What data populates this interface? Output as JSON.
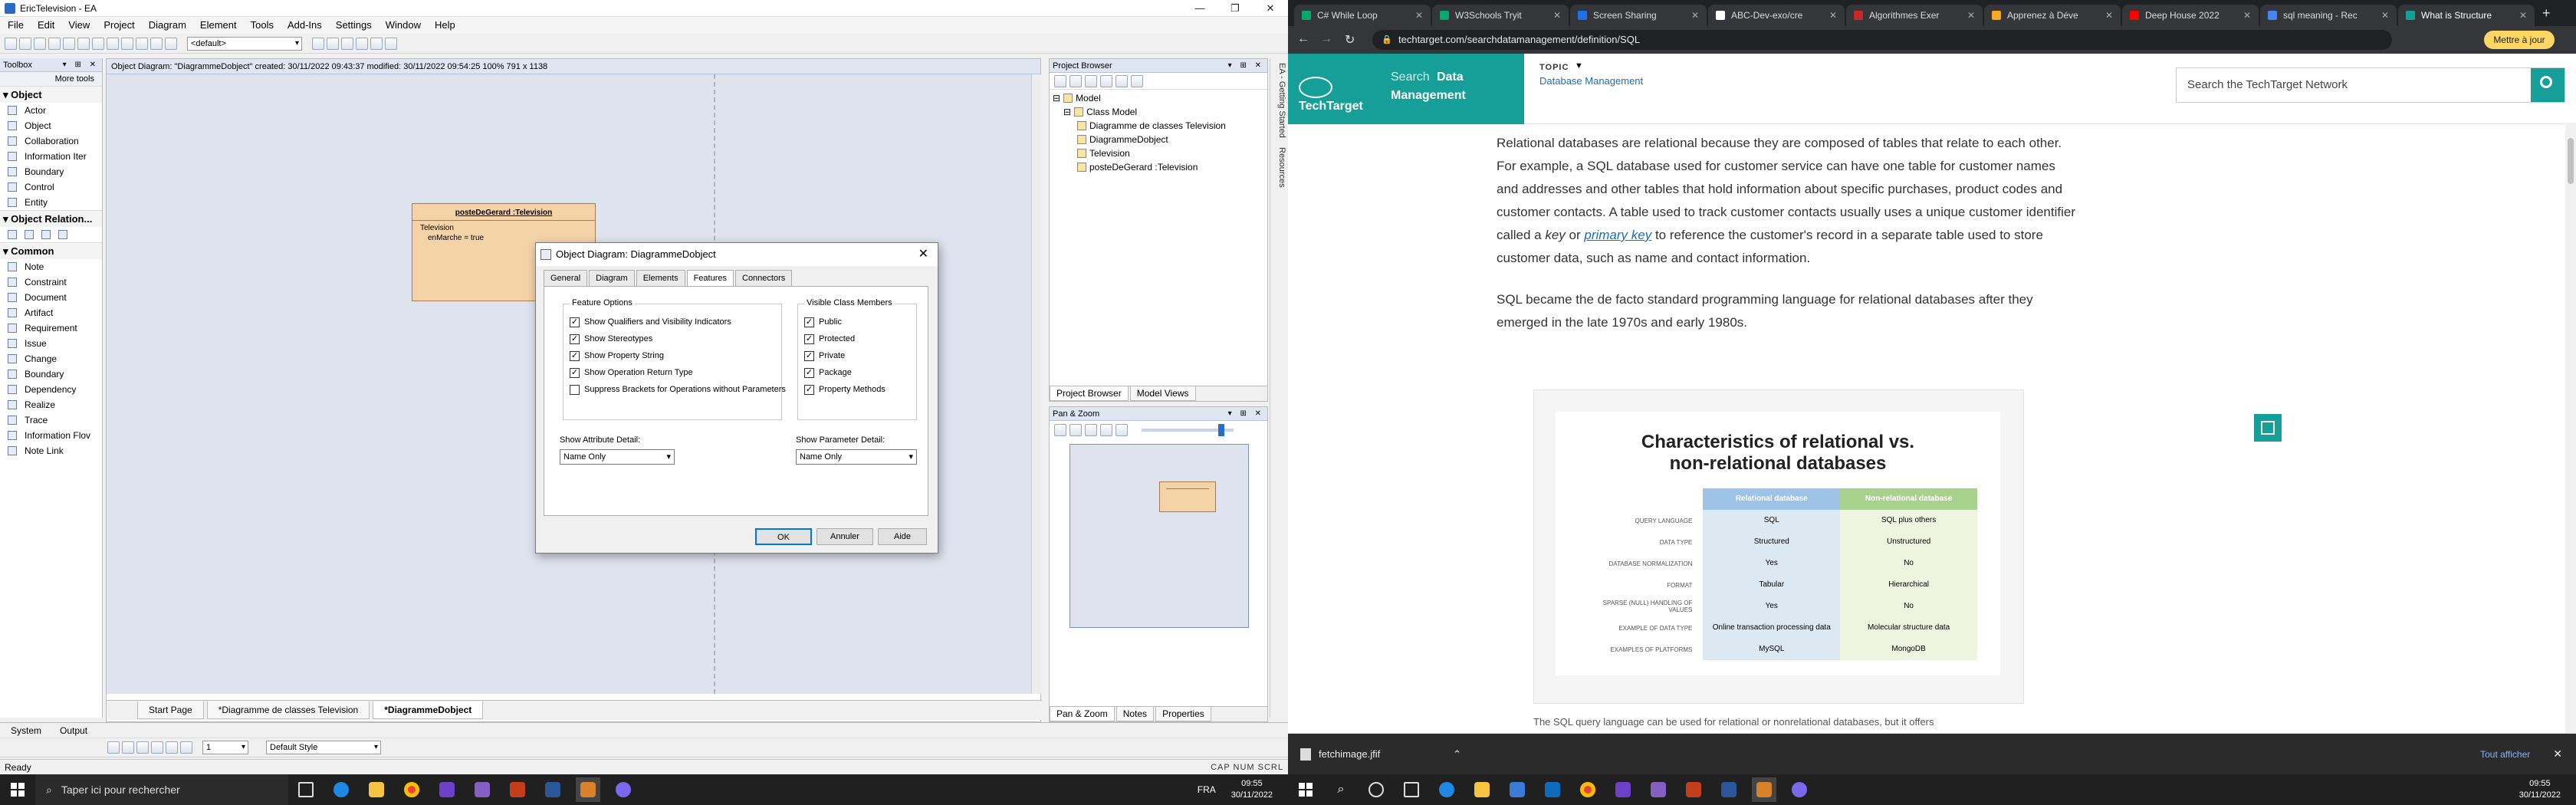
{
  "ea": {
    "title": "EricTelevision - EA",
    "menu": [
      "File",
      "Edit",
      "View",
      "Project",
      "Diagram",
      "Element",
      "Tools",
      "Add-Ins",
      "Settings",
      "Window",
      "Help"
    ],
    "toolbar_select": "<default>",
    "toolbox": {
      "title": "Toolbox",
      "more_tools": "More tools",
      "groups": [
        {
          "name": "Object",
          "items": [
            "Actor",
            "Object",
            "Collaboration",
            "Information Iter",
            "Boundary",
            "Control",
            "Entity"
          ]
        },
        {
          "name": "Object Relation...",
          "items": []
        },
        {
          "name": "Common",
          "items": [
            "Note",
            "Constraint",
            "Document",
            "Artifact",
            "Requirement",
            "Issue",
            "Change",
            "Boundary",
            "Dependency",
            "Realize",
            "Trace",
            "Information Flov",
            "Note Link"
          ]
        }
      ]
    },
    "diagram_header": "Object Diagram: \"DiagrammeDobject\"   created: 30/11/2022 09:43:37  modified: 30/11/2022 09:54:25   100%   791 x 1138",
    "class_box": {
      "name": "posteDeGerard :Television",
      "stereo": "Television",
      "attr": "enMarche = true"
    },
    "doc_tabs": [
      "Start Page",
      "*Diagramme de classes Television",
      "*DiagrammeDobject"
    ],
    "dialog": {
      "title": "Object Diagram: DiagrammeDobject",
      "tabs": [
        "General",
        "Diagram",
        "Elements",
        "Features",
        "Connectors"
      ],
      "feature_group": "Feature Options",
      "feature_options": [
        {
          "label": "Show Qualifiers and Visibility Indicators",
          "checked": true
        },
        {
          "label": "Show Stereotypes",
          "checked": true
        },
        {
          "label": "Show Property String",
          "checked": true
        },
        {
          "label": "Show Operation Return Type",
          "checked": true
        },
        {
          "label": "Suppress Brackets for Operations without Parameters",
          "checked": false
        }
      ],
      "members_group": "Visible Class Members",
      "members": [
        {
          "label": "Public",
          "checked": true
        },
        {
          "label": "Protected",
          "checked": true
        },
        {
          "label": "Private",
          "checked": true
        },
        {
          "label": "Package",
          "checked": true
        },
        {
          "label": "Property Methods",
          "checked": true
        }
      ],
      "attr_detail_label": "Show Attribute Detail:",
      "attr_detail_value": "Name Only",
      "param_detail_label": "Show Parameter Detail:",
      "param_detail_value": "Name Only",
      "ok": "OK",
      "cancel": "Annuler",
      "help": "Aide"
    },
    "project_browser": {
      "title": "Project Browser",
      "tree": [
        {
          "label": "Model",
          "level": 0
        },
        {
          "label": "Class Model",
          "level": 1
        },
        {
          "label": "Diagramme de classes Television",
          "level": 2
        },
        {
          "label": "DiagrammeDobject",
          "level": 2
        },
        {
          "label": "Television",
          "level": 2
        },
        {
          "label": "posteDeGerard :Television",
          "level": 2
        }
      ],
      "tabs": [
        "Project Browser",
        "Model Views"
      ]
    },
    "side_tabs": [
      "EA - Getting Started",
      "Resources"
    ],
    "pan_zoom": {
      "title": "Pan & Zoom",
      "tabs": [
        "Pan & Zoom",
        "Notes",
        "Properties"
      ]
    },
    "bottom_tabs": [
      "System",
      "Output"
    ],
    "style_select": "Default Style",
    "zoom_select": "1",
    "status": "Ready",
    "status_right": "CAP  NUM  SCRL"
  },
  "taskbar_left": {
    "search_placeholder": "Taper ici pour rechercher",
    "lang": "FRA",
    "time": "09:55",
    "date": "30/11/2022"
  },
  "browser": {
    "tabs": [
      {
        "label": "C# While Loop",
        "color": "#04aa6d"
      },
      {
        "label": "W3Schools Tryit",
        "color": "#04aa6d"
      },
      {
        "label": "Screen Sharing",
        "color": "#1a73e8"
      },
      {
        "label": "ABC-Dev-exo/cre",
        "color": "#ffffff"
      },
      {
        "label": "Algorithmes Exer",
        "color": "#c62828"
      },
      {
        "label": "Apprenez à Déve",
        "color": "#f9a825"
      },
      {
        "label": "Deep House 2022",
        "color": "#ff0000"
      },
      {
        "label": "sql meaning - Rec",
        "color": "#4285f4"
      },
      {
        "label": "What is Structure",
        "color": "#169f99"
      }
    ],
    "url": "techtarget.com/searchdatamanagement/definition/SQL",
    "update_button": "Mettre à jour",
    "site": {
      "logo": "TechTarget",
      "search_brand": "Search",
      "search_brand2": "Data",
      "search_brand3": "Management",
      "topic_label": "TOPIC",
      "topic_value": "Database Management",
      "search_placeholder": "Search the TechTarget Network"
    },
    "article": {
      "p1a": "Relational databases are relational because they are composed of tables that relate to each other. For example, a SQL database used for customer service can have one table for customer names and addresses and other tables that hold information about specific purchases, product codes and customer contacts. A table used to track customer contacts usually uses a unique customer identifier called a ",
      "p1_key": "key",
      "p1_or": " or ",
      "p1_link": "primary key",
      "p1b": " to reference the customer's record in a separate table used to store customer data, such as name and contact information.",
      "p2": "SQL became the de facto standard programming language for relational databases after they emerged in the late 1970s and early 1980s.",
      "caption": "The SQL query language can be used for relational or nonrelational databases, but it offers"
    },
    "figure": {
      "title": "Characteristics of relational vs. non-relational databases",
      "col1": "Relational database",
      "col2": "Non-relational database",
      "rows": [
        {
          "k": "QUERY LANGUAGE",
          "a": "SQL",
          "b": "SQL plus others"
        },
        {
          "k": "DATA TYPE",
          "a": "Structured",
          "b": "Unstructured"
        },
        {
          "k": "DATABASE NORMALIZATION",
          "a": "Yes",
          "b": "No"
        },
        {
          "k": "FORMAT",
          "a": "Tabular",
          "b": "Hierarchical"
        },
        {
          "k": "SPARSE (NULL) HANDLING OF VALUES",
          "a": "Yes",
          "b": "No"
        },
        {
          "k": "EXAMPLE OF DATA TYPE",
          "a": "Online transaction processing data",
          "b": "Molecular structure data"
        },
        {
          "k": "EXAMPLES OF PLATFORMS",
          "a": "MySQL",
          "b": "MongoDB"
        }
      ]
    },
    "download": {
      "file": "fetchimage.jfif",
      "show_all": "Tout afficher"
    }
  },
  "taskbar_right": {
    "time": "09:55",
    "date": "30/11/2022"
  },
  "colors": {
    "accent": "#169f99",
    "class_fill": "#f5d3a8",
    "canvas": "#dfe3ee"
  }
}
